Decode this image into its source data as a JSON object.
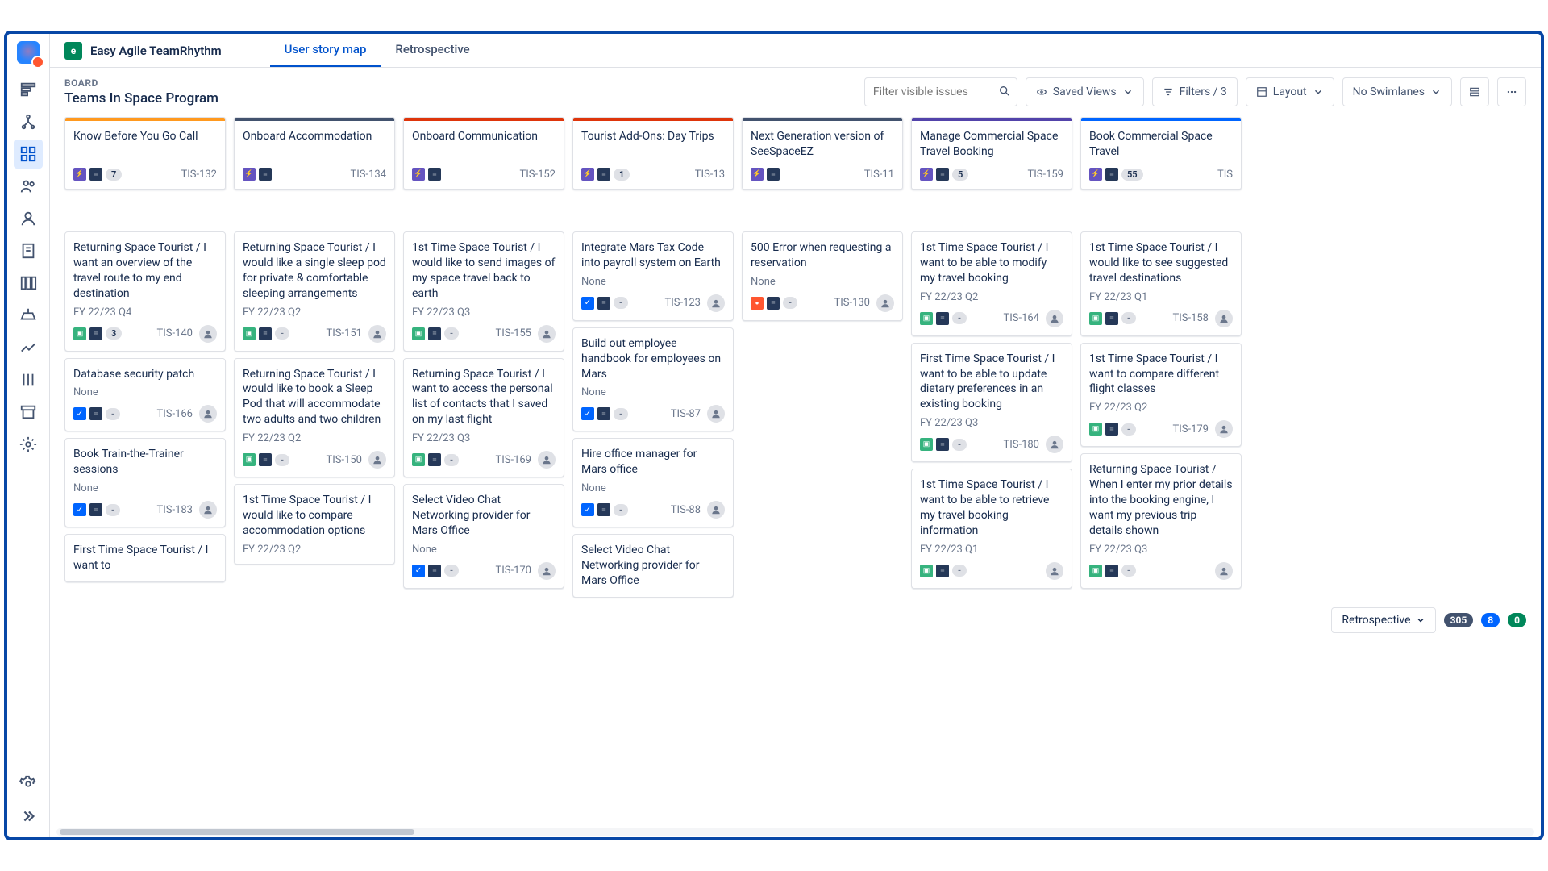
{
  "app": {
    "badge": "e",
    "name": "Easy Agile TeamRhythm"
  },
  "tabs": [
    {
      "label": "User story map",
      "active": true
    },
    {
      "label": "Retrospective",
      "active": false
    }
  ],
  "board": {
    "label": "BOARD",
    "title": "Teams In Space Program"
  },
  "toolbar": {
    "search_placeholder": "Filter visible issues",
    "saved_views": "Saved Views",
    "filters": "Filters / 3",
    "layout": "Layout",
    "swimlanes": "No Swimlanes"
  },
  "retro": {
    "label": "Retrospective",
    "counts": {
      "grey": "305",
      "blue": "8",
      "green": "0"
    }
  },
  "columns": [
    {
      "epic": {
        "title": "Know Before You Go Call",
        "count": "7",
        "key": "TIS-132",
        "stripe": "#ff991f"
      },
      "cards": [
        {
          "title": "Returning Space Tourist / I want an overview of the travel route to my end destination",
          "sprint": "FY 22/23 Q4",
          "type": "story",
          "count": "3",
          "key": "TIS-140"
        },
        {
          "title": "Database security patch",
          "sprint": "None",
          "type": "task",
          "count": "-",
          "key": "TIS-166"
        },
        {
          "title": "Book Train-the-Trainer sessions",
          "sprint": "None",
          "type": "task",
          "count": "-",
          "key": "TIS-183"
        },
        {
          "title": "First Time Space Tourist / I want to",
          "sprint": "",
          "type": "",
          "count": "",
          "key": ""
        }
      ]
    },
    {
      "epic": {
        "title": "Onboard Accommodation",
        "count": "",
        "key": "TIS-134",
        "stripe": "#42526e"
      },
      "cards": [
        {
          "title": "Returning Space Tourist / I would like a single sleep pod for private & comfortable sleeping arrangements",
          "sprint": "FY 22/23 Q2",
          "type": "story",
          "count": "-",
          "key": "TIS-151"
        },
        {
          "title": "Returning Space Tourist / I would like to book a Sleep Pod that will accommodate two adults and two children",
          "sprint": "FY 22/23 Q2",
          "type": "story",
          "count": "-",
          "key": "TIS-150"
        },
        {
          "title": "1st Time Space Tourist / I would like to compare accommodation options",
          "sprint": "FY 22/23 Q2",
          "type": "",
          "count": "",
          "key": ""
        }
      ]
    },
    {
      "epic": {
        "title": "Onboard Communication",
        "count": "",
        "key": "TIS-152",
        "stripe": "#de350b"
      },
      "cards": [
        {
          "title": "1st Time Space Tourist / I would like to send images of my space travel back to earth",
          "sprint": "FY 22/23 Q3",
          "type": "story",
          "count": "-",
          "key": "TIS-155"
        },
        {
          "title": "Returning Space Tourist / I want to access the personal list of contacts that I saved on my last flight",
          "sprint": "FY 22/23 Q3",
          "type": "story",
          "count": "-",
          "key": "TIS-169"
        },
        {
          "title": "Select Video Chat Networking provider for Mars Office",
          "sprint": "None",
          "type": "task",
          "count": "-",
          "key": "TIS-170"
        }
      ]
    },
    {
      "epic": {
        "title": "Tourist Add-Ons: Day Trips",
        "count": "1",
        "key": "TIS-13",
        "stripe": "#de350b"
      },
      "cards": [
        {
          "title": "Integrate Mars Tax Code into payroll system on Earth",
          "sprint": "None",
          "type": "task",
          "count": "-",
          "key": "TIS-123"
        },
        {
          "title": "Build out employee handbook for employees on Mars",
          "sprint": "None",
          "type": "task",
          "count": "-",
          "key": "TIS-87"
        },
        {
          "title": "Hire office manager for Mars office",
          "sprint": "None",
          "type": "task",
          "count": "-",
          "key": "TIS-88"
        },
        {
          "title": "Select Video Chat Networking provider for Mars Office",
          "sprint": "",
          "type": "",
          "count": "",
          "key": ""
        }
      ]
    },
    {
      "epic": {
        "title": "Next Generation version of SeeSpaceEZ",
        "count": "",
        "key": "TIS-11",
        "stripe": "#42526e"
      },
      "cards": [
        {
          "title": "500 Error when requesting a reservation",
          "sprint": "None",
          "type": "bug",
          "count": "-",
          "key": "TIS-130"
        }
      ]
    },
    {
      "epic": {
        "title": "Manage Commercial Space Travel Booking",
        "count": "5",
        "key": "TIS-159",
        "stripe": "#5243aa"
      },
      "cards": [
        {
          "title": "1st Time Space Tourist / I want to be able to modify my travel booking",
          "sprint": "FY 22/23 Q2",
          "type": "story",
          "count": "-",
          "key": "TIS-164"
        },
        {
          "title": "First Time Space Tourist / I want to be able to update dietary preferences in an existing booking",
          "sprint": "FY 22/23 Q3",
          "type": "story",
          "count": "-",
          "key": "TIS-180"
        },
        {
          "title": "1st Time Space Tourist / I want to be able to retrieve my travel booking information",
          "sprint": "FY 22/23 Q1",
          "type": "story",
          "count": "",
          "key": ""
        }
      ]
    },
    {
      "epic": {
        "title": "Book Commercial Space Travel",
        "count": "55",
        "key": "TIS",
        "stripe": "#0065ff"
      },
      "cards": [
        {
          "title": "1st Time Space Tourist / I would like to see suggested travel destinations",
          "sprint": "FY 22/23 Q1",
          "type": "story",
          "count": "-",
          "key": "TIS-158"
        },
        {
          "title": "1st Time Space Tourist / I want to compare different flight classes",
          "sprint": "FY 22/23 Q2",
          "type": "story",
          "count": "-",
          "key": "TIS-179"
        },
        {
          "title": "Returning Space Tourist / When I enter my prior details into the booking engine, I want my previous trip details shown",
          "sprint": "FY 22/23 Q3",
          "type": "story",
          "count": "",
          "key": ""
        }
      ]
    }
  ]
}
